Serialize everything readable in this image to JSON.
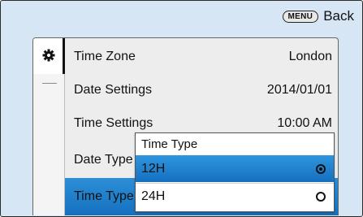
{
  "header": {
    "menu_button": "MENU",
    "back_label": "Back"
  },
  "rail": {
    "icon": "gear-icon"
  },
  "settings": {
    "items": [
      {
        "label": "Time Zone",
        "value": "London"
      },
      {
        "label": "Date Settings",
        "value": "2014/01/01"
      },
      {
        "label": "Time Settings",
        "value": "10:00 AM"
      },
      {
        "label": "Date Type",
        "value": ""
      },
      {
        "label": "Time Type",
        "value": ""
      }
    ]
  },
  "dropdown": {
    "title": "Time Type",
    "options": [
      {
        "label": "12H",
        "selected": true
      },
      {
        "label": "24H",
        "selected": false
      }
    ]
  },
  "colors": {
    "screen_bg": "#d7e6f5",
    "highlight": "#1f80cc"
  }
}
